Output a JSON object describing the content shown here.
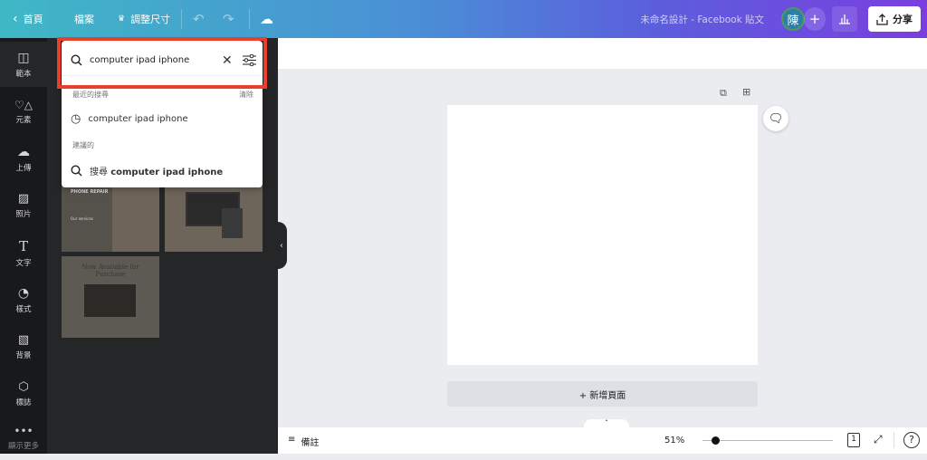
{
  "topbar": {
    "home": "首頁",
    "file": "檔案",
    "resize": "調整尺寸",
    "title": "未命名設計 - Facebook 貼文",
    "avatar_initial": "陳",
    "share": "分享"
  },
  "sidebar": {
    "items": [
      {
        "label": "範本",
        "icon": "template-icon"
      },
      {
        "label": "元素",
        "icon": "shapes-icon"
      },
      {
        "label": "上傳",
        "icon": "cloud-upload-icon"
      },
      {
        "label": "照片",
        "icon": "photo-icon"
      },
      {
        "label": "文字",
        "icon": "text-icon"
      },
      {
        "label": "樣式",
        "icon": "palette-icon"
      },
      {
        "label": "背景",
        "icon": "background-icon"
      },
      {
        "label": "標誌",
        "icon": "logo-icon"
      },
      {
        "label": "顯示更多",
        "icon": "more-icon"
      }
    ]
  },
  "search": {
    "value": "computer ipad iphone",
    "recent_header": "最近的搜尋",
    "clear": "清除",
    "recent_item": "computer ipad iphone",
    "suggested_header": "建議的",
    "suggest_prefix": "搜尋",
    "suggest_query": "computer ipad iphone"
  },
  "templates": {
    "t1": "PHONE REPAIR",
    "t1_sub": "Our services",
    "t3": "Now Available for Purchase"
  },
  "canvas": {
    "add_page": "+ 新增頁面"
  },
  "bottom": {
    "notes": "備註",
    "zoom": "51%",
    "zoom_fraction": 0.1,
    "page_count": "1"
  },
  "colors": {
    "highlight": "#e8402a",
    "rail": "#18191b",
    "panel": "#252627"
  }
}
